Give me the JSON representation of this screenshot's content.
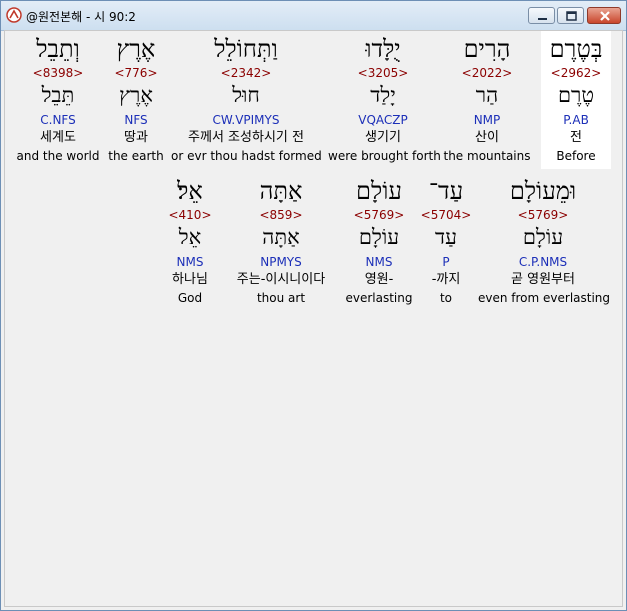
{
  "window": {
    "title": "@원전본해 - 시 90:2"
  },
  "verse": [
    {
      "hebrew": "בְּטֶרֶם",
      "strong": "<2962>",
      "lemma": "טֶרֶם",
      "morph": "P.AB",
      "korean": "전",
      "english": "Before"
    },
    {
      "hebrew": "הָרִים",
      "strong": "<2022>",
      "lemma": "הַר",
      "morph": "NMP",
      "korean": "산이",
      "english": "the mountains"
    },
    {
      "hebrew": "יֻלָּדוּ",
      "strong": "<3205>",
      "lemma": "יָלַד",
      "morph": "VQACZP",
      "korean": "생기기",
      "english": "were brought forth"
    },
    {
      "hebrew": "וַתְּחוֹלֵל",
      "strong": "<2342>",
      "lemma": "חוּל",
      "morph": "CW.VPIMYS",
      "korean": "주께서 조성하시기 전",
      "english": "or evr thou hadst formed"
    },
    {
      "hebrew": "אֶרֶץ",
      "strong": "<776>",
      "lemma": "אֶרֶץ",
      "morph": "NFS",
      "korean": "땅과",
      "english": "the earth"
    },
    {
      "hebrew": "וְתֵבֵל",
      "strong": "<8398>",
      "lemma": "תֵּבֵל",
      "morph": "C.NFS",
      "korean": "세계도",
      "english": "and the world"
    },
    {
      "hebrew": "וּמֵעוֹלָם",
      "strong": "<5769>",
      "lemma": "עוֹלָם",
      "morph": "C.P.NMS",
      "korean": "곧 영원부터",
      "english": "even from everlasting"
    },
    {
      "hebrew": "עַד־",
      "strong": "<5704>",
      "lemma": "עַד",
      "morph": "P",
      "korean": "-까지",
      "english": "to"
    },
    {
      "hebrew": "עוֹלָם",
      "strong": "<5769>",
      "lemma": "עוֹלָם",
      "morph": "NMS",
      "korean": "영원-",
      "english": "everlasting"
    },
    {
      "hebrew": "אַתָּה",
      "strong": "<859>",
      "lemma": "אַתָּה",
      "morph": "NPMYS",
      "korean": "주는-이시니이다",
      "english": "thou art"
    },
    {
      "hebrew": "אֵל׃",
      "strong": "<410>",
      "lemma": "אֵל",
      "morph": "NMS",
      "korean": "하나님",
      "english": "God"
    }
  ],
  "colors": {
    "strong": "#8b0000",
    "morph": "#1c2fb8",
    "highlight": "#ffffff",
    "titlebar": "#dbe7f4"
  },
  "icons": {
    "app": "app-logo-icon",
    "minimize": "minimize-icon",
    "maximize": "maximize-icon",
    "close": "close-icon"
  }
}
